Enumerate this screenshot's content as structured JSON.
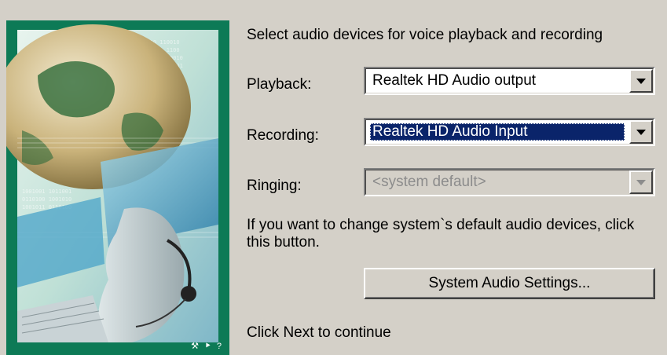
{
  "intro_text": "Select audio devices for voice playback and recording",
  "playback": {
    "label": "Playback:",
    "value": "Realtek HD Audio output"
  },
  "recording": {
    "label": "Recording:",
    "value": "Realtek HD Audio Input"
  },
  "ringing": {
    "label": "Ringing:",
    "value": "<system default>",
    "disabled": true
  },
  "note_text": "If you want to change system`s default audio devices, click this button.",
  "system_button_label": "System Audio Settings...",
  "footer_text": "Click Next to continue",
  "art_icons": "⚒ ⯈ ?",
  "colors": {
    "background": "#d4d0c8",
    "selection": "#0a246a",
    "art_green": "#0d7a56"
  },
  "icons": [
    "dropdown-arrow-icon",
    "globe-icon",
    "headset-icon"
  ]
}
